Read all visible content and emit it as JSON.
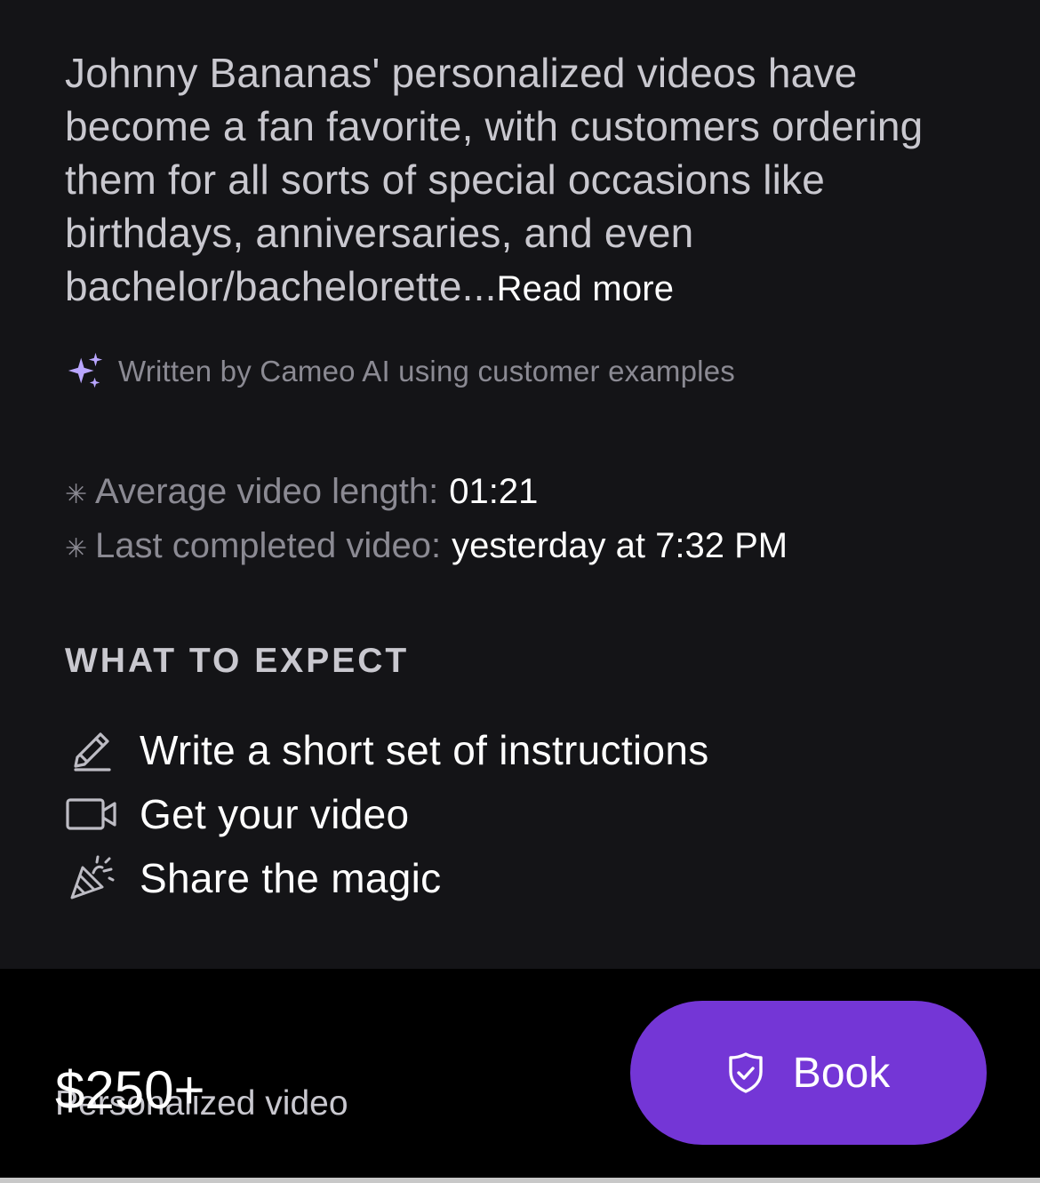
{
  "bio": {
    "text": "Johnny Bananas' personalized videos have become a fan favorite, with customers ordering them for all sorts of special occasions like birthdays, anniversaries, and even bachelor/bachelorette...",
    "read_more": "Read more"
  },
  "ai_note": {
    "icon": "sparkle-icon",
    "text": "Written by Cameo AI using customer examples"
  },
  "stats": [
    {
      "label": "Average video length:",
      "value": "01:21"
    },
    {
      "label": "Last completed video:",
      "value": "yesterday at 7:32 PM"
    }
  ],
  "expect": {
    "title": "WHAT TO EXPECT",
    "items": [
      {
        "icon": "pencil-icon",
        "text": "Write a short set of instructions"
      },
      {
        "icon": "video-camera-icon",
        "text": "Get your video"
      },
      {
        "icon": "party-popper-icon",
        "text": "Share the magic"
      }
    ]
  },
  "footer": {
    "price_label": "Personalized video",
    "price": "$250+",
    "book_label": "Book",
    "book_icon": "shield-check-icon"
  },
  "colors": {
    "background": "#141417",
    "footer_background": "#000000",
    "accent": "#7436d6",
    "sparkle": "#b9a6ff"
  }
}
